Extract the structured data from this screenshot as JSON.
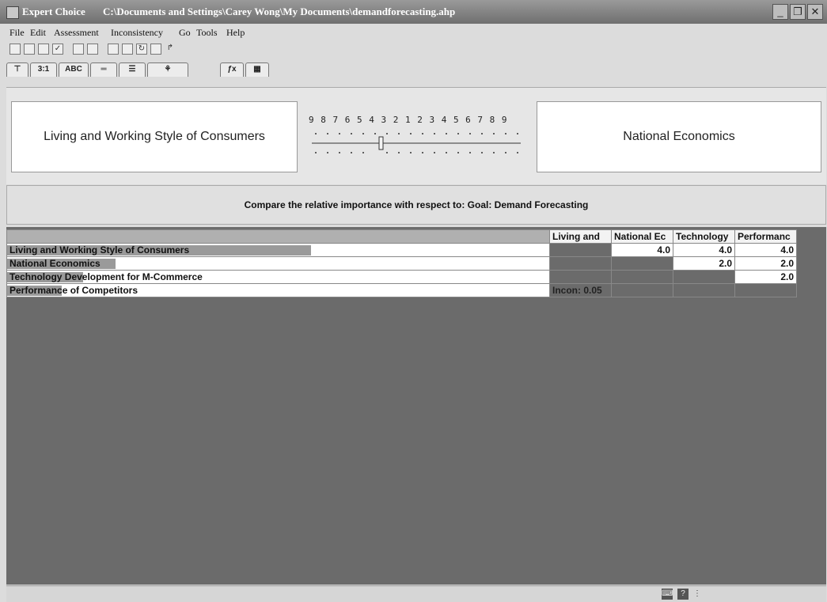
{
  "window": {
    "app_name": "Expert Choice",
    "file_path": "C:\\Documents and Settings\\Carey Wong\\My Documents\\demandforecasting.ahp",
    "minimize": "_",
    "restore": "❐",
    "close": "✕"
  },
  "menu": [
    "File",
    "Edit",
    "Assessment",
    "Inconsistency",
    "Go",
    "Tools",
    "Help"
  ],
  "toolbar_icons": [
    "new-icon",
    "open-icon",
    "save-icon",
    "check-icon",
    "print-icon",
    "print-preview-icon",
    "model-icon",
    "chart-icon",
    "refresh-icon",
    "tools-icon",
    "arrow-icon"
  ],
  "tabs": [
    {
      "name": "tree-view-tab",
      "label": "⊤"
    },
    {
      "name": "numerical-tab",
      "label": "3:1"
    },
    {
      "name": "verbal-tab",
      "label": "ABC"
    },
    {
      "name": "graphical-tab",
      "label": "═"
    },
    {
      "name": "questionnaire-tab",
      "label": "☰"
    },
    {
      "name": "hierarchy-tab",
      "label": "⚘"
    },
    {
      "name": "formula-tab",
      "label": "ƒx"
    },
    {
      "name": "grid-tab",
      "label": "▦"
    }
  ],
  "comparison": {
    "left_element": "Living and Working Style of Consumers",
    "right_element": "National Economics",
    "scale_labels": "9 8 7 6 5 4 3 2 1 2 3 4 5 6 7 8 9",
    "slider_value": 4
  },
  "prompt": "Compare the relative importance with respect to: Goal: Demand Forecasting",
  "matrix": {
    "columns": [
      "Living and",
      "National Ec",
      "Technology",
      "Performanc"
    ],
    "rows": [
      {
        "label": "Living and Working Style of Consumers",
        "bar": 0.56,
        "cells": [
          "",
          "4.0",
          "4.0",
          "4.0"
        ]
      },
      {
        "label": "National Economics",
        "bar": 0.2,
        "cells": [
          "",
          "",
          "2.0",
          "2.0"
        ]
      },
      {
        "label": "Technology Development for M-Commerce",
        "bar": 0.14,
        "cells": [
          "",
          "",
          "",
          "2.0"
        ]
      },
      {
        "label": "Performance of Competitors",
        "bar": 0.1,
        "cells": [
          "Incon: 0.05",
          "",
          "",
          ""
        ]
      }
    ]
  },
  "status": {
    "icons": [
      "keyboard-icon",
      "help-icon",
      "resize-icon"
    ]
  },
  "colors": {
    "titlebar": "#7a7a7a",
    "grid_background": "#6b6b6b",
    "priority_bar": "#9a9a9a"
  }
}
